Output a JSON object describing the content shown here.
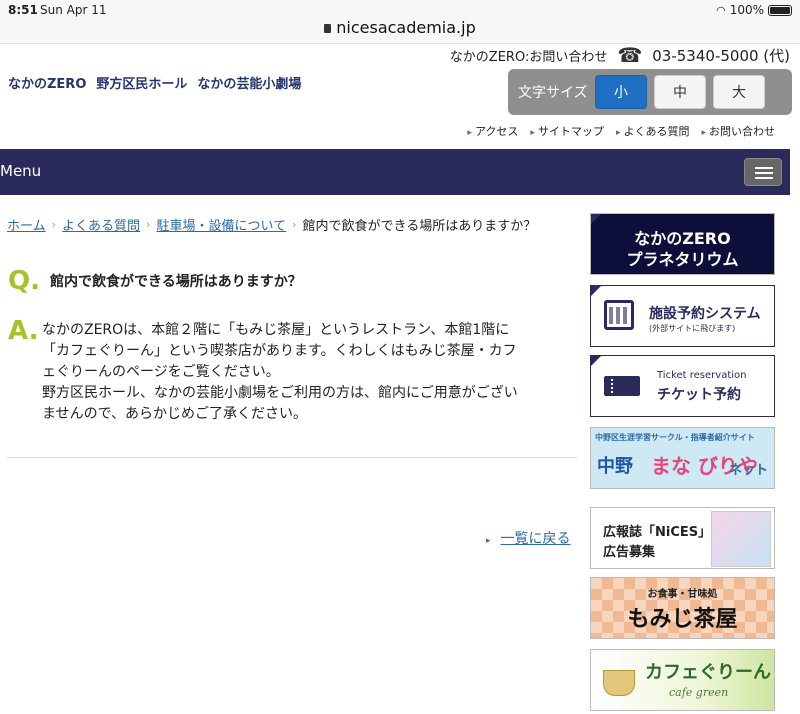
{
  "status_bar": {
    "time": "8:51",
    "date": "Sun Apr 11",
    "url": "nicesacademia.jp",
    "battery": "100%"
  },
  "header": {
    "contact_label": "なかのZERO:お問い合わせ",
    "phone": "03-5340-5000 (代)",
    "site_names": [
      "なかのZERO",
      "野方区民ホール",
      "なかの芸能小劇場"
    ],
    "font_size": {
      "label": "文字サイズ",
      "small": "小",
      "medium": "中",
      "large": "大",
      "active": "小"
    },
    "top_links": [
      "アクセス",
      "サイトマップ",
      "よくある質問",
      "お問い合わせ"
    ]
  },
  "menu": {
    "label": "Menu"
  },
  "breadcrumb": {
    "home": "ホーム",
    "faq": "よくある質問",
    "category": "駐車場・設備について",
    "current": "館内で飲食ができる場所はありますか？"
  },
  "qa": {
    "q_mark": "Q.",
    "question": "館内で飲食ができる場所はありますか？",
    "a_mark": "A.",
    "answer_lines": [
      "なかのZEROは、本館２階に「もみじ茶屋」というレストラン、本館1階に",
      "「カフェぐりーん」という喫茶店があります。くわしくはもみじ茶屋・カフ",
      "ェぐりーんのページをご覧ください。",
      "野方区民ホール、なかの芸能小劇場をご利用の方は、館内にご用意がござい",
      "ませんので、あらかじめご了承ください。"
    ]
  },
  "back_link": "一覧に戻る",
  "banners": {
    "planetarium": {
      "line1": "なかのZERO",
      "line2": "プラネタリウム"
    },
    "facility": {
      "title": "施設予約システム",
      "sub": "(外部サイトに飛びます)"
    },
    "ticket": {
      "sub": "Ticket reservation",
      "title": "チケット予約"
    },
    "manabiya": {
      "small": "中野区生涯学習サークル・指導者紹介サイト",
      "nakano": "中野",
      "brand": "まな びりや",
      "net": "ネット"
    },
    "nices": {
      "line1": "広報誌「NiCES」",
      "line2": "広告募集"
    },
    "momiji": {
      "small": "お食事・甘味処",
      "title": "もみじ茶屋"
    },
    "cafe": {
      "title": "カフェぐりーん",
      "sub": "cafe green"
    }
  }
}
